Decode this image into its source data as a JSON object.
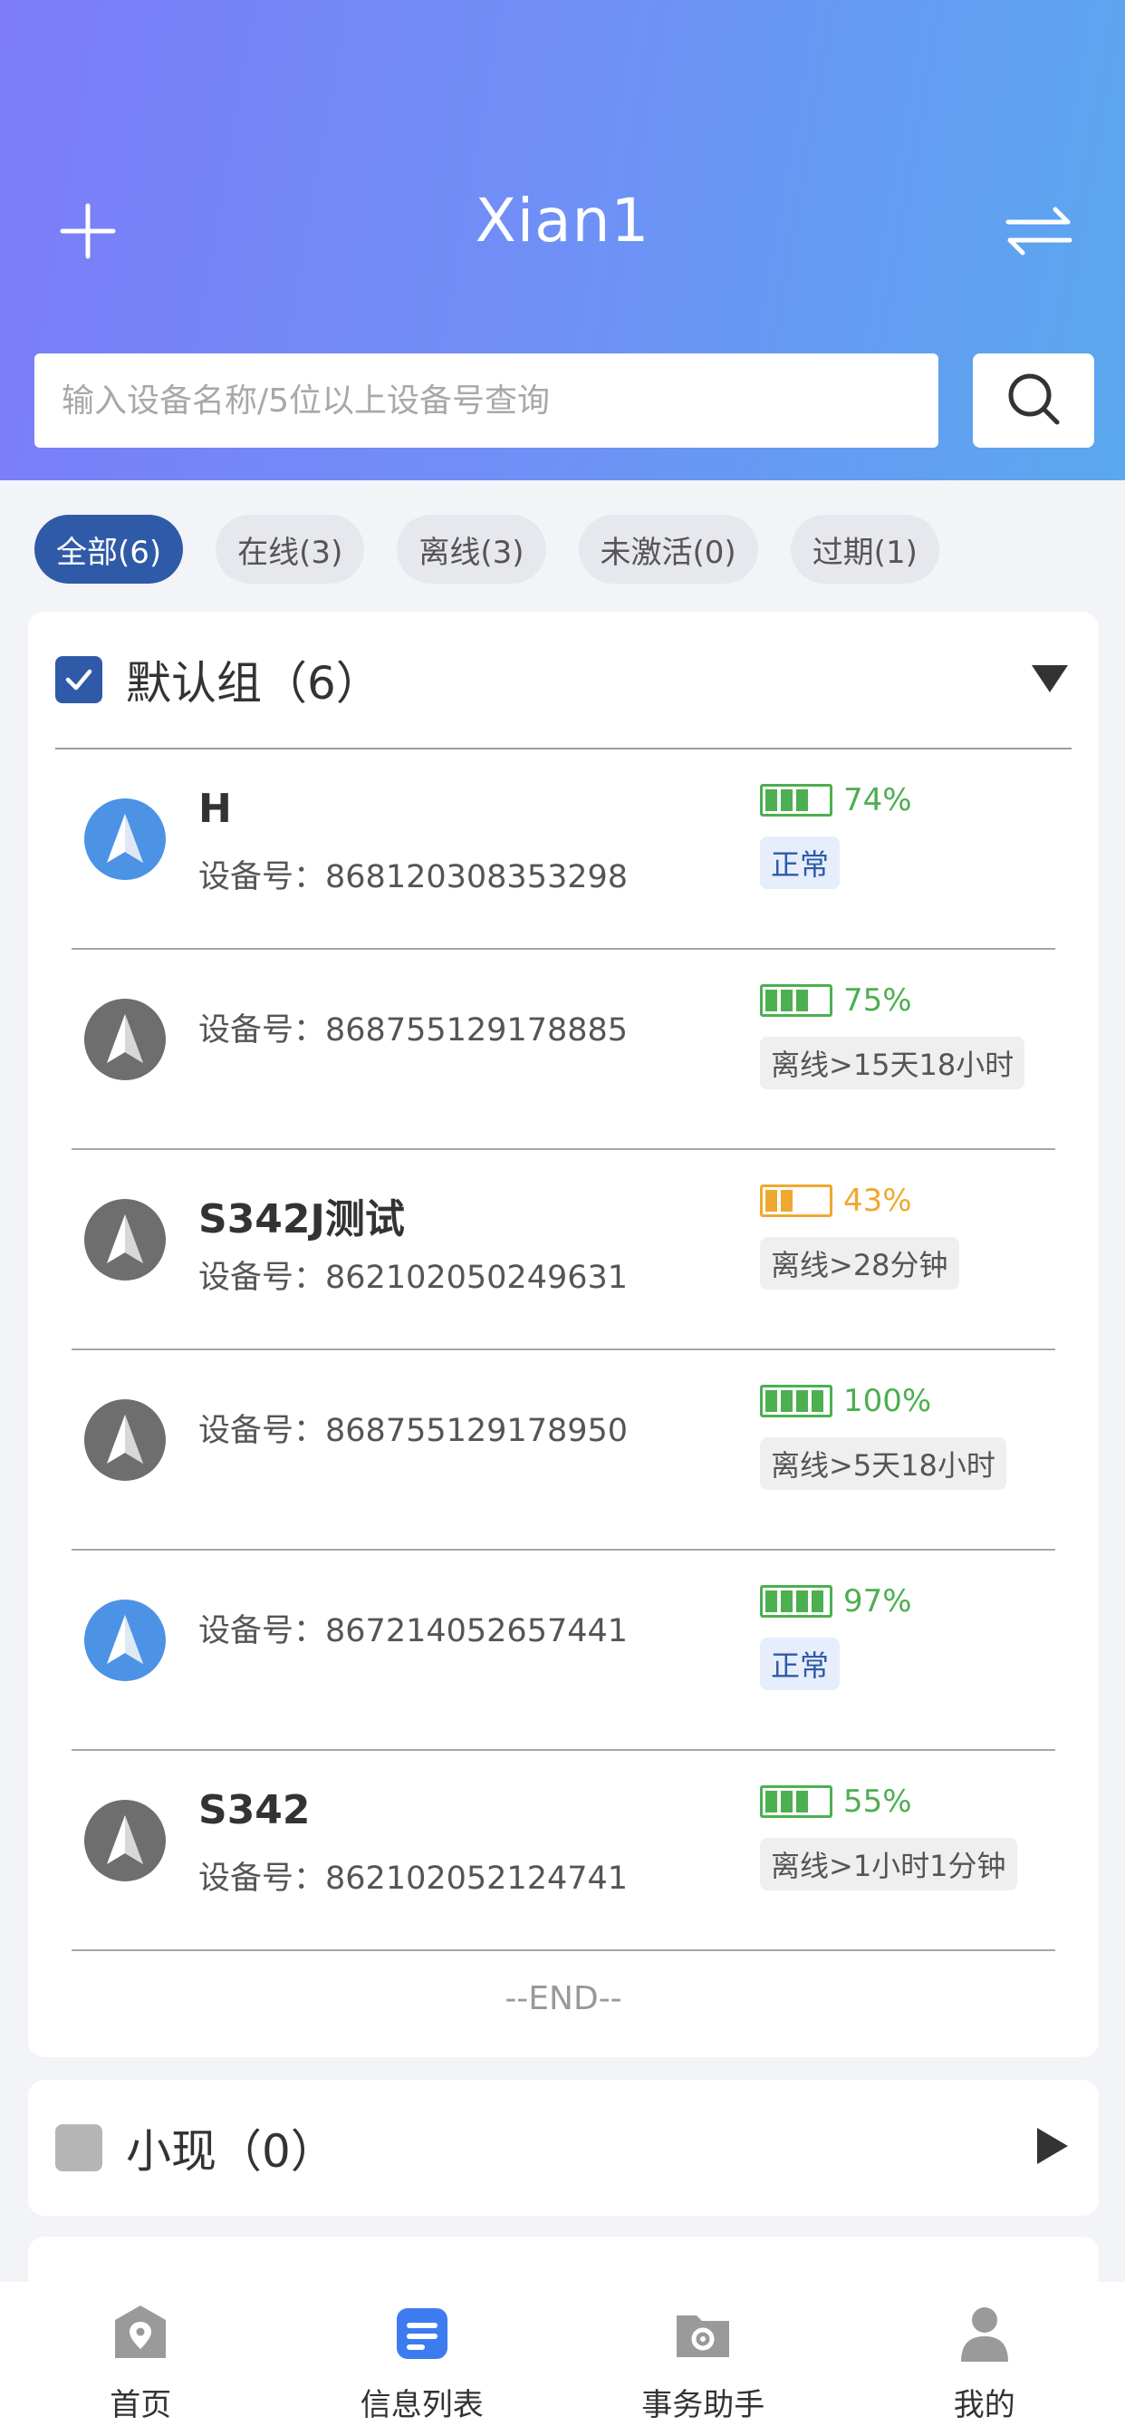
{
  "header": {
    "title": "Xian1",
    "add_icon": "plus-icon",
    "switch_icon": "swap-arrows-icon"
  },
  "search": {
    "placeholder": "输入设备名称/5位以上设备号查询",
    "button_icon": "search-icon"
  },
  "filters": [
    {
      "label": "全部(6)",
      "active": true
    },
    {
      "label": "在线(3)",
      "active": false
    },
    {
      "label": "离线(3)",
      "active": false
    },
    {
      "label": "未激活(0)",
      "active": false
    },
    {
      "label": "过期(1)",
      "active": false
    }
  ],
  "groups": [
    {
      "title": "默认组（6）",
      "checked": true,
      "expanded": true,
      "devices": [
        {
          "name": "H",
          "id_label": "设备号：",
          "id": "868120308353298",
          "battery_pct": "74%",
          "battery_level": 0.74,
          "status": "正常",
          "online": true
        },
        {
          "name": "",
          "id_label": "设备号：",
          "id": "868755129178885",
          "battery_pct": "75%",
          "battery_level": 0.75,
          "status": "离线>15天18小时",
          "online": false
        },
        {
          "name": "S342J测试",
          "id_label": "设备号：",
          "id": "862102050249631",
          "battery_pct": "43%",
          "battery_level": 0.43,
          "status": "离线>28分钟",
          "online": false
        },
        {
          "name": "",
          "id_label": "设备号：",
          "id": "868755129178950",
          "battery_pct": "100%",
          "battery_level": 1.0,
          "status": "离线>5天18小时",
          "online": false
        },
        {
          "name": "",
          "id_label": "设备号：",
          "id": "867214052657441",
          "battery_pct": "97%",
          "battery_level": 0.97,
          "status": "正常",
          "online": true
        },
        {
          "name": "S342",
          "id_label": "设备号：",
          "id": "862102052124741",
          "battery_pct": "55%",
          "battery_level": 0.55,
          "status": "离线>1小时1分钟",
          "online": false
        }
      ],
      "end_text": "--END--"
    },
    {
      "title": "小现（0）",
      "checked": false,
      "expanded": false
    }
  ],
  "colors": {
    "accent": "#2f5aa8",
    "battery_green": "#4caf50",
    "battery_orange": "#f0a830",
    "online_avatar": "#4c93e6",
    "offline_avatar": "#6e6e6e"
  },
  "tabbar": [
    {
      "label": "首页",
      "icon": "home-location-icon",
      "active": false
    },
    {
      "label": "信息列表",
      "icon": "message-list-icon",
      "active": true
    },
    {
      "label": "事务助手",
      "icon": "folder-gear-icon",
      "active": false
    },
    {
      "label": "我的",
      "icon": "user-profile-icon",
      "active": false
    }
  ]
}
